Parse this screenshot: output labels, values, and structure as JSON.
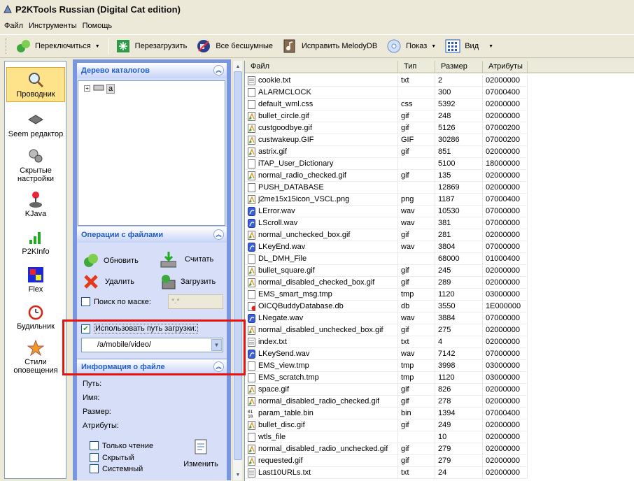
{
  "window": {
    "title": "P2KTools Russian (Digital Cat edition)"
  },
  "menu": [
    "Файл",
    "Инструменты",
    "Помощь"
  ],
  "toolbar": {
    "switch_label": "Переключиться",
    "reboot_label": "Перезагрузить",
    "silent_label": "Все бесшумные",
    "melody_label": "Исправить MelodyDB",
    "show_label": "Показ",
    "view_label": "Вид"
  },
  "sidebar": {
    "items": [
      {
        "label": "Проводник",
        "icon": "magnifier-icon"
      },
      {
        "label": "Seem редактор",
        "icon": "seem-editor-icon"
      },
      {
        "label": "Скрытые настройки",
        "icon": "hidden-settings-icon"
      },
      {
        "label": "KJava",
        "icon": "joystick-icon"
      },
      {
        "label": "P2KInfo",
        "icon": "signal-bars-icon"
      },
      {
        "label": "Flex",
        "icon": "flex-icon"
      },
      {
        "label": "Будильник",
        "icon": "alarm-clock-icon"
      },
      {
        "label": "Стили оповещения",
        "icon": "alert-styles-icon"
      }
    ]
  },
  "tree_panel": {
    "title": "Дерево каталогов",
    "root": "a"
  },
  "ops_panel": {
    "title": "Операции с файлами",
    "refresh": "Обновить",
    "read": "Считать",
    "delete": "Удалить",
    "upload": "Загрузить",
    "mask_label": "Поиск по маске:",
    "mask_value": "*.*",
    "use_path_label": "Использовать путь загрузки:",
    "use_path_checked": true,
    "path_value": "/a/mobile/video/"
  },
  "info_panel": {
    "title": "Информация о файле",
    "path_label": "Путь:",
    "name_label": "Имя:",
    "size_label": "Размер:",
    "attr_label": "Атрибуты:",
    "readonly": "Только чтение",
    "hidden": "Скрытый",
    "system": "Системный",
    "change": "Изменить"
  },
  "file_list": {
    "columns": [
      "Файл",
      "Тип",
      "Размер",
      "Атрибуты"
    ],
    "rows": [
      {
        "name": "cookie.txt",
        "type": "txt",
        "size": "2",
        "attr": "02000000",
        "icon": "text-file-icon"
      },
      {
        "name": "ALARMCLOCK",
        "type": "",
        "size": "300",
        "attr": "07000400",
        "icon": "blank-file-icon"
      },
      {
        "name": "default_wml.css",
        "type": "css",
        "size": "5392",
        "attr": "02000000",
        "icon": "blank-file-icon"
      },
      {
        "name": "bullet_circle.gif",
        "type": "gif",
        "size": "248",
        "attr": "02000000",
        "icon": "image-file-icon"
      },
      {
        "name": "custgoodbye.gif",
        "type": "gif",
        "size": "5126",
        "attr": "07000200",
        "icon": "image-file-icon"
      },
      {
        "name": "custwakeup.GIF",
        "type": "GIF",
        "size": "30286",
        "attr": "07000200",
        "icon": "image-file-icon"
      },
      {
        "name": "astrix.gif",
        "type": "gif",
        "size": "851",
        "attr": "02000000",
        "icon": "image-file-icon"
      },
      {
        "name": "iTAP_User_Dictionary",
        "type": "",
        "size": "5100",
        "attr": "18000000",
        "icon": "blank-file-icon"
      },
      {
        "name": "normal_radio_checked.gif",
        "type": "gif",
        "size": "135",
        "attr": "02000000",
        "icon": "image-file-icon"
      },
      {
        "name": "PUSH_DATABASE",
        "type": "",
        "size": "12869",
        "attr": "02000000",
        "icon": "blank-file-icon"
      },
      {
        "name": "j2me15x15icon_VSCL.png",
        "type": "png",
        "size": "1187",
        "attr": "07000400",
        "icon": "image-file-icon"
      },
      {
        "name": "LError.wav",
        "type": "wav",
        "size": "10530",
        "attr": "07000000",
        "icon": "audio-file-icon"
      },
      {
        "name": "LScroll.wav",
        "type": "wav",
        "size": "381",
        "attr": "07000000",
        "icon": "audio-file-icon"
      },
      {
        "name": "normal_unchecked_box.gif",
        "type": "gif",
        "size": "281",
        "attr": "02000000",
        "icon": "image-file-icon"
      },
      {
        "name": "LKeyEnd.wav",
        "type": "wav",
        "size": "3804",
        "attr": "07000000",
        "icon": "audio-file-icon"
      },
      {
        "name": "DL_DMH_File",
        "type": "",
        "size": "68000",
        "attr": "01000400",
        "icon": "blank-file-icon"
      },
      {
        "name": "bullet_square.gif",
        "type": "gif",
        "size": "245",
        "attr": "02000000",
        "icon": "image-file-icon"
      },
      {
        "name": "normal_disabled_checked_box.gif",
        "type": "gif",
        "size": "289",
        "attr": "02000000",
        "icon": "image-file-icon"
      },
      {
        "name": "EMS_smart_msg.tmp",
        "type": "tmp",
        "size": "1120",
        "attr": "03000000",
        "icon": "blank-file-icon"
      },
      {
        "name": "OICQBuddyDatabase.db",
        "type": "db",
        "size": "3550",
        "attr": "1E000000",
        "icon": "db-file-icon"
      },
      {
        "name": "LNegate.wav",
        "type": "wav",
        "size": "3884",
        "attr": "07000000",
        "icon": "audio-file-icon"
      },
      {
        "name": "normal_disabled_unchecked_box.gif",
        "type": "gif",
        "size": "275",
        "attr": "02000000",
        "icon": "image-file-icon"
      },
      {
        "name": "index.txt",
        "type": "txt",
        "size": "4",
        "attr": "02000000",
        "icon": "text-file-icon"
      },
      {
        "name": "LKeySend.wav",
        "type": "wav",
        "size": "7142",
        "attr": "07000000",
        "icon": "audio-file-icon"
      },
      {
        "name": "EMS_view.tmp",
        "type": "tmp",
        "size": "3998",
        "attr": "03000000",
        "icon": "blank-file-icon"
      },
      {
        "name": "EMS_scratch.tmp",
        "type": "tmp",
        "size": "1120",
        "attr": "03000000",
        "icon": "blank-file-icon"
      },
      {
        "name": "space.gif",
        "type": "gif",
        "size": "826",
        "attr": "02000000",
        "icon": "image-file-icon"
      },
      {
        "name": "normal_disabled_radio_checked.gif",
        "type": "gif",
        "size": "278",
        "attr": "02000000",
        "icon": "image-file-icon"
      },
      {
        "name": "param_table.bin",
        "type": "bin",
        "size": "1394",
        "attr": "07000400",
        "icon": "binary-file-icon"
      },
      {
        "name": "bullet_disc.gif",
        "type": "gif",
        "size": "249",
        "attr": "02000000",
        "icon": "image-file-icon"
      },
      {
        "name": "wtls_file",
        "type": "",
        "size": "10",
        "attr": "02000000",
        "icon": "blank-file-icon"
      },
      {
        "name": "normal_disabled_radio_unchecked.gif",
        "type": "gif",
        "size": "279",
        "attr": "02000000",
        "icon": "image-file-icon"
      },
      {
        "name": "requested.gif",
        "type": "gif",
        "size": "279",
        "attr": "02000000",
        "icon": "image-file-icon"
      },
      {
        "name": "Last10URLs.txt",
        "type": "txt",
        "size": "24",
        "attr": "02000000",
        "icon": "text-file-icon"
      }
    ]
  },
  "colors": {
    "highlight_box": "#e8130f",
    "panel_blue": "#7a96df",
    "panel_head_text": "#215dc6",
    "active_item": "#ffe38a"
  }
}
